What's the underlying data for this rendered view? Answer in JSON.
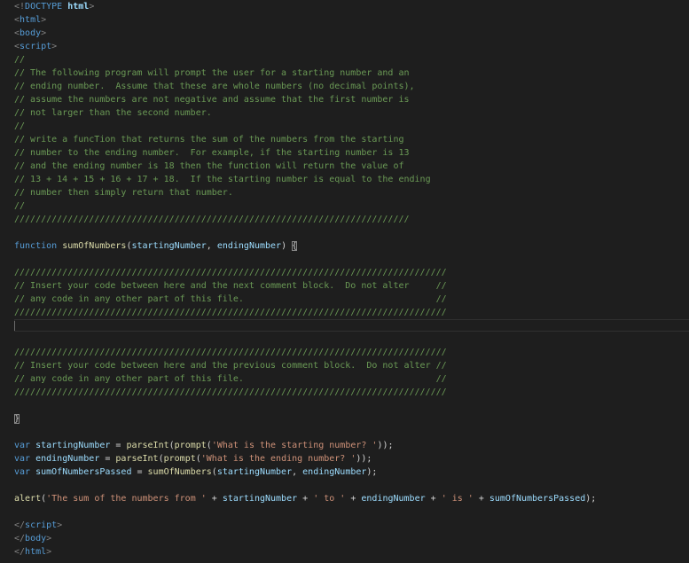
{
  "editor": {
    "lines": [
      [
        [
          "punct",
          "<!"
        ],
        [
          "doctype",
          "DOCTYPE"
        ],
        [
          "plain",
          " "
        ],
        [
          "doctype-name",
          "html"
        ],
        [
          "punct",
          ">"
        ]
      ],
      [
        [
          "punct",
          "<"
        ],
        [
          "tag",
          "html"
        ],
        [
          "punct",
          ">"
        ]
      ],
      [
        [
          "punct",
          "<"
        ],
        [
          "tag",
          "body"
        ],
        [
          "punct",
          ">"
        ]
      ],
      [
        [
          "punct",
          "<"
        ],
        [
          "tag",
          "script"
        ],
        [
          "punct",
          ">"
        ]
      ],
      [
        [
          "comment",
          "//"
        ]
      ],
      [
        [
          "comment",
          "// The following program will prompt the user for a starting number and an"
        ]
      ],
      [
        [
          "comment",
          "// ending number.  Assume that these are whole numbers (no decimal points),"
        ]
      ],
      [
        [
          "comment",
          "// assume the numbers are not negative and assume that the first number is"
        ]
      ],
      [
        [
          "comment",
          "// not larger than the second number."
        ]
      ],
      [
        [
          "comment",
          "//"
        ]
      ],
      [
        [
          "comment",
          "// write a funcTion that returns the sum of the numbers from the starting"
        ]
      ],
      [
        [
          "comment",
          "// number to the ending number.  For example, if the starting number is 13"
        ]
      ],
      [
        [
          "comment",
          "// and the ending number is 18 then the function will return the value of"
        ]
      ],
      [
        [
          "comment",
          "// 13 + 14 + 15 + 16 + 17 + 18.  If the starting number is equal to the ending"
        ]
      ],
      [
        [
          "comment",
          "// number then simply return that number."
        ]
      ],
      [
        [
          "comment",
          "//"
        ]
      ],
      [
        [
          "comment",
          "//////////////////////////////////////////////////////////////////////////"
        ]
      ],
      [],
      [
        [
          "kw",
          "function"
        ],
        [
          "plain",
          " "
        ],
        [
          "fn",
          "sumOfNumbers"
        ],
        [
          "plain",
          "("
        ],
        [
          "var",
          "startingNumber"
        ],
        [
          "plain",
          ", "
        ],
        [
          "var",
          "endingNumber"
        ],
        [
          "plain",
          ") "
        ],
        [
          "bracket-match",
          "{"
        ]
      ],
      [],
      [
        [
          "comment",
          "/////////////////////////////////////////////////////////////////////////////////"
        ]
      ],
      [
        [
          "comment",
          "// Insert your code between here and the next comment block.  Do not alter     //"
        ]
      ],
      [
        [
          "comment",
          "// any code in any other part of this file.                                    //"
        ]
      ],
      [
        [
          "comment",
          "/////////////////////////////////////////////////////////////////////////////////"
        ]
      ],
      [],
      [],
      [
        [
          "comment",
          "/////////////////////////////////////////////////////////////////////////////////"
        ]
      ],
      [
        [
          "comment",
          "// Insert your code between here and the previous comment block.  Do not alter //"
        ]
      ],
      [
        [
          "comment",
          "// any code in any other part of this file.                                    //"
        ]
      ],
      [
        [
          "comment",
          "/////////////////////////////////////////////////////////////////////////////////"
        ]
      ],
      [],
      [
        [
          "bracket-match",
          "}"
        ]
      ],
      [],
      [
        [
          "kw",
          "var"
        ],
        [
          "plain",
          " "
        ],
        [
          "var",
          "startingNumber"
        ],
        [
          "plain",
          " = "
        ],
        [
          "fn",
          "parseInt"
        ],
        [
          "plain",
          "("
        ],
        [
          "fn",
          "prompt"
        ],
        [
          "plain",
          "("
        ],
        [
          "str",
          "'What is the starting number? '"
        ],
        [
          "plain",
          "));"
        ]
      ],
      [
        [
          "kw",
          "var"
        ],
        [
          "plain",
          " "
        ],
        [
          "var",
          "endingNumber"
        ],
        [
          "plain",
          " = "
        ],
        [
          "fn",
          "parseInt"
        ],
        [
          "plain",
          "("
        ],
        [
          "fn",
          "prompt"
        ],
        [
          "plain",
          "("
        ],
        [
          "str",
          "'What is the ending number? '"
        ],
        [
          "plain",
          "));"
        ]
      ],
      [
        [
          "kw",
          "var"
        ],
        [
          "plain",
          " "
        ],
        [
          "var",
          "sumOfNumbersPassed"
        ],
        [
          "plain",
          " = "
        ],
        [
          "fn",
          "sumOfNumbers"
        ],
        [
          "plain",
          "("
        ],
        [
          "var",
          "startingNumber"
        ],
        [
          "plain",
          ", "
        ],
        [
          "var",
          "endingNumber"
        ],
        [
          "plain",
          ");"
        ]
      ],
      [],
      [
        [
          "fn",
          "alert"
        ],
        [
          "plain",
          "("
        ],
        [
          "str",
          "'The sum of the numbers from '"
        ],
        [
          "plain",
          " + "
        ],
        [
          "var",
          "startingNumber"
        ],
        [
          "plain",
          " + "
        ],
        [
          "str",
          "' to '"
        ],
        [
          "plain",
          " + "
        ],
        [
          "var",
          "endingNumber"
        ],
        [
          "plain",
          " + "
        ],
        [
          "str",
          "' is '"
        ],
        [
          "plain",
          " + "
        ],
        [
          "var",
          "sumOfNumbersPassed"
        ],
        [
          "plain",
          ");"
        ]
      ],
      [],
      [
        [
          "punct",
          "</"
        ],
        [
          "tag",
          "script"
        ],
        [
          "punct",
          ">"
        ]
      ],
      [
        [
          "punct",
          "</"
        ],
        [
          "tag",
          "body"
        ],
        [
          "punct",
          ">"
        ]
      ],
      [
        [
          "punct",
          "</"
        ],
        [
          "tag",
          "html"
        ],
        [
          "punct",
          ">"
        ]
      ]
    ]
  }
}
